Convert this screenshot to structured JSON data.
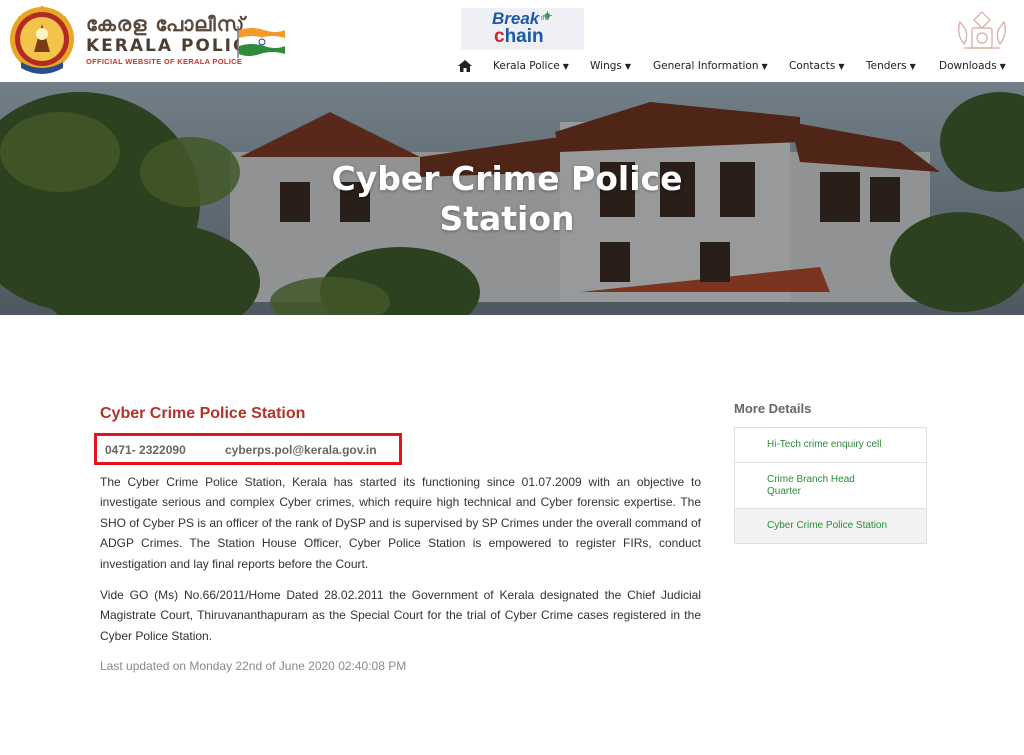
{
  "header": {
    "brand_malayalam": "കേരള പോലീസ്",
    "brand_english": "KERALA  POLICE",
    "brand_tagline": "OFFICIAL WEBSITE OF KERALA POLICE",
    "campaign_line1": "Break",
    "campaign_the": "the",
    "campaign_line2_a": "c",
    "campaign_line2_b": "hain"
  },
  "nav": {
    "items": [
      {
        "label": "Kerala Police"
      },
      {
        "label": "Wings"
      },
      {
        "label": "General Information"
      },
      {
        "label": "Contacts"
      },
      {
        "label": "Tenders"
      },
      {
        "label": "Downloads"
      }
    ]
  },
  "hero": {
    "title_line1": "Cyber Crime Police",
    "title_line2": "Station"
  },
  "main": {
    "heading": "Cyber Crime Police Station",
    "phone": "0471- 2322090",
    "email": "cyberps.pol@kerala.gov.in",
    "paragraph1": "The Cyber Crime Police Station, Kerala has started its functioning since 01.07.2009 with an objective to investigate serious and complex Cyber crimes, which require high technical and Cyber forensic expertise. The SHO of Cyber PS is an officer of the rank of DySP and is  supervised by SP Crimes under the overall command of ADGP Crimes. The Station House Officer, Cyber Police Station is empowered to register FIRs, conduct investigation and  lay final reports before the Court.",
    "paragraph2": "Vide GO (Ms) No.66/2011/Home Dated 28.02.2011 the Government of Kerala designated the Chief Judicial Magistrate Court, Thiruvananthapuram as the Special Court for the trial of Cyber Crime cases registered in the Cyber Police Station.",
    "last_updated": "Last updated on Monday 22nd of June 2020 02:40:08 PM"
  },
  "sidebar": {
    "title": "More Details",
    "items": [
      {
        "label": "Hi-Tech crime enquiry cell"
      },
      {
        "label": "Crime Branch Head Quarter"
      },
      {
        "label": "Cyber Crime Police Station"
      }
    ]
  },
  "colors": {
    "heading_red": "#b5322a",
    "highlight_border": "#e2131a",
    "sidebar_link_green": "#2e8b3a"
  }
}
